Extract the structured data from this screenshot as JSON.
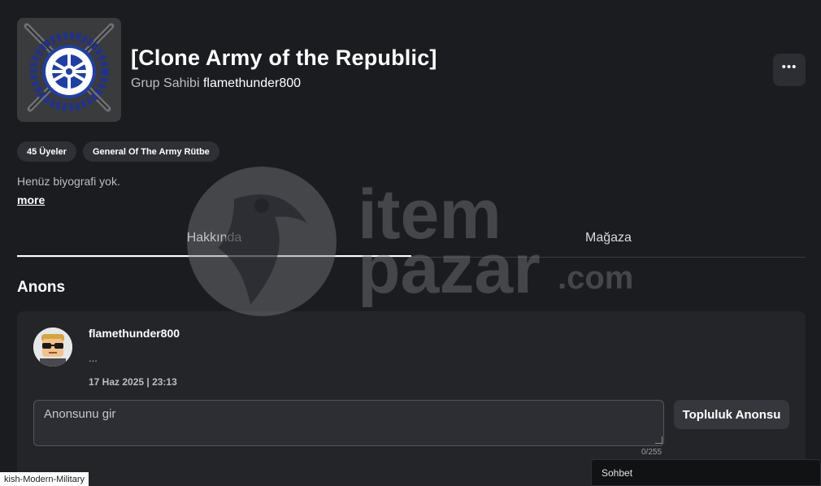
{
  "group": {
    "title": "[Clone Army of the Republic]",
    "owner_prefix": "Grup Sahibi",
    "owner_name": "flamethunder800",
    "more_icon": "ellipsis-icon",
    "emblem_icon": "galactic-republic-emblem"
  },
  "chips": {
    "members": "45 Üyeler",
    "rank": "General Of The Army Rütbe"
  },
  "bio": {
    "text": "Henüz biyografi yok.",
    "more_label": "more"
  },
  "tabs": [
    {
      "label": "Hakkında",
      "active": true
    },
    {
      "label": "Mağaza",
      "active": false
    }
  ],
  "announcements": {
    "section_title": "Anons",
    "post": {
      "author": "flamethunder800",
      "body": "...",
      "date": "17 Haz 2025 | 23:13"
    },
    "input_placeholder": "Anonsunu gir",
    "char_count": "0/255",
    "submit_label": "Topluluk Anonsu"
  },
  "status_tooltip": "kish-Modern-Military",
  "chat_label": "Sohbet",
  "watermark": {
    "line1": "item",
    "line2": "pazar",
    "suffix": ".com"
  },
  "colors": {
    "background": "#1b1c20",
    "card": "#232529",
    "chip": "#2e3035",
    "emblem_blue": "#1f3fa8"
  }
}
